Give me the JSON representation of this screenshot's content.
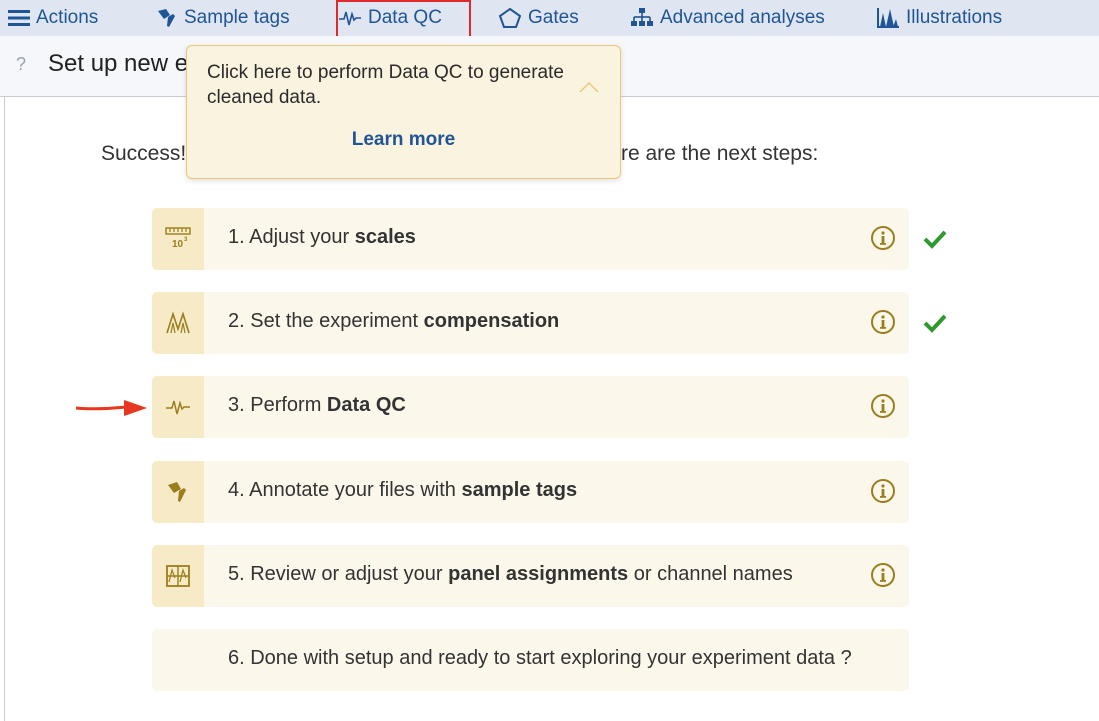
{
  "nav": {
    "actions": "Actions",
    "sample_tags": "Sample tags",
    "data_qc": "Data QC",
    "gates": "Gates",
    "advanced": "Advanced analyses",
    "illustrations": "Illustrations"
  },
  "subheader": {
    "help": "?",
    "title": "Set up new e"
  },
  "tooltip": {
    "text": "Click here to perform Data QC to generate cleaned data.",
    "link": "Learn more"
  },
  "success": {
    "left": "Success!",
    "right": "re are the next steps:"
  },
  "steps": [
    {
      "prefix": "1. Adjust your ",
      "bold": "scales",
      "suffix": "",
      "done": true,
      "icon": "scales-icon"
    },
    {
      "prefix": "2. Set the experiment ",
      "bold": "compensation",
      "suffix": "",
      "done": true,
      "icon": "compensation-icon"
    },
    {
      "prefix": "3. Perform ",
      "bold": "Data QC",
      "suffix": "",
      "done": false,
      "icon": "data-qc-icon"
    },
    {
      "prefix": "4. Annotate your files with ",
      "bold": "sample tags",
      "suffix": "",
      "done": false,
      "icon": "tag-icon"
    },
    {
      "prefix": "5. Review or adjust your ",
      "bold": "panel assignments",
      "suffix": " or channel names",
      "done": false,
      "icon": "panel-icon"
    },
    {
      "prefix": "6. Done with setup and ready to start exploring your experiment data ?",
      "bold": "",
      "suffix": "",
      "done": false,
      "icon": ""
    }
  ],
  "colors": {
    "nav_bg": "#dfe6f2",
    "link": "#1f5596",
    "accent_gold": "#9a7d1c",
    "check_green": "#2e9a2e",
    "highlight_red": "#e0292b",
    "arrow_red": "#e8361f"
  }
}
